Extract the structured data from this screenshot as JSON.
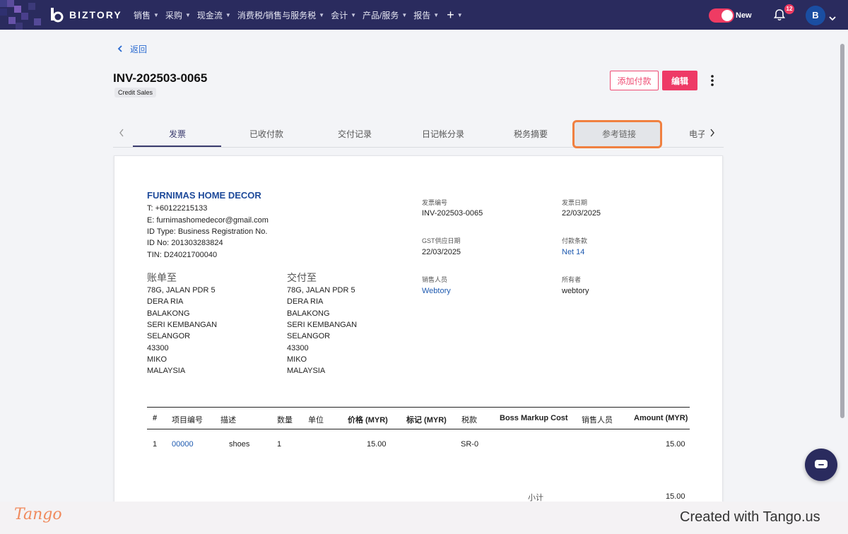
{
  "brand": {
    "name": "BIZTORY"
  },
  "nav": {
    "items": [
      {
        "label": "销售"
      },
      {
        "label": "采购"
      },
      {
        "label": "现金流"
      },
      {
        "label": "消费税/销售与服务税"
      },
      {
        "label": "会计"
      },
      {
        "label": "产品/服务"
      },
      {
        "label": "报告"
      }
    ],
    "new_label": "New",
    "notifications_count": "12",
    "avatar_initial": "B"
  },
  "page": {
    "back_label": "返回",
    "invoice_number": "INV-202503-0065",
    "tag": "Credit Sales",
    "add_payment_label": "添加付款",
    "edit_label": "编辑"
  },
  "tabs": [
    {
      "label": "发票"
    },
    {
      "label": "已收付款"
    },
    {
      "label": "交付记录"
    },
    {
      "label": "日记帐分录"
    },
    {
      "label": "税务摘要"
    },
    {
      "label": "参考链接"
    },
    {
      "label": "电子"
    }
  ],
  "invoice": {
    "company": "FURNIMAS HOME DECOR",
    "info": [
      "T: +60122215133",
      "E: furnimashomedecor@gmail.com",
      "ID Type: Business Registration No.",
      "ID No: 201303283824",
      "TIN: D24021700040"
    ],
    "bill_to_label": "账单至",
    "ship_to_label": "交付至",
    "bill_to": [
      "78G, JALAN PDR 5",
      "DERA RIA",
      "BALAKONG",
      "SERI KEMBANGAN",
      "SELANGOR",
      "43300",
      "MIKO",
      "MALAYSIA"
    ],
    "ship_to": [
      "78G, JALAN PDR 5",
      "DERA RIA",
      "BALAKONG",
      "SERI KEMBANGAN",
      "SELANGOR",
      "43300",
      "MIKO",
      "MALAYSIA"
    ],
    "meta": {
      "invoice_no_label": "发票编号",
      "invoice_no": "INV-202503-0065",
      "invoice_date_label": "发票日期",
      "invoice_date": "22/03/2025",
      "gst_date_label": "GST供应日期",
      "gst_date": "22/03/2025",
      "terms_label": "付款条款",
      "terms": "Net 14",
      "salesperson_label": "销售人员",
      "salesperson": "Webtory",
      "owner_label": "所有者",
      "owner": "webtory"
    },
    "table": {
      "headers": [
        "#",
        "项目编号",
        "描述",
        "数量",
        "单位",
        "价格 (MYR)",
        "标记 (MYR)",
        "税款",
        "Boss Markup Cost",
        "销售人员",
        "Amount (MYR)"
      ],
      "rows": [
        {
          "index": "1",
          "item_code": "00000",
          "description": "shoes",
          "qty": "1",
          "price": "15.00",
          "tax": "SR-0",
          "amount": "15.00"
        }
      ]
    },
    "subtotal_label": "小计",
    "subtotal": "15.00"
  },
  "footer": {
    "logo_text": "Tango",
    "created_text": "Created with Tango.us"
  }
}
